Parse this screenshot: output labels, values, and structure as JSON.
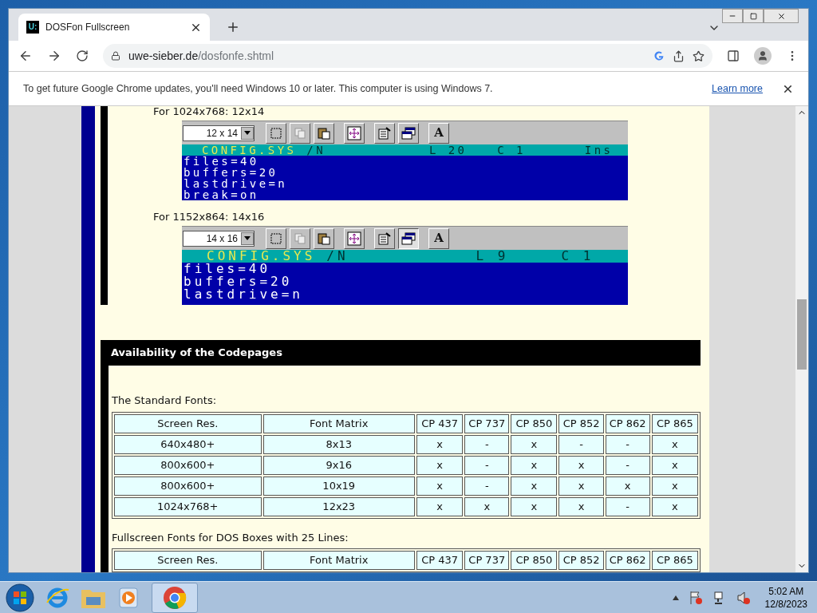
{
  "browser": {
    "tab_title": "DOSFon Fullscreen",
    "favicon_text": "U:",
    "url_host": "uwe-sieber.de",
    "url_path": "/dosfonfe.shtml",
    "infobar": {
      "message": "To get future Google Chrome updates, you'll need Windows 10 or later. This computer is using Windows 7.",
      "link": "Learn more"
    }
  },
  "page": {
    "screenshots": [
      {
        "caption": "For 1024x768: 12x14",
        "font_size": "12 x 14",
        "font_button": "A",
        "file": "CONFIG.SYS",
        "switch": "/N",
        "line": "L 20",
        "col": "C 1",
        "mode": "Ins",
        "lines": [
          "files=40",
          "buffers=20",
          "lastdrive=n",
          "break=on"
        ]
      },
      {
        "caption": "For 1152x864: 14x16",
        "font_size": "14 x 16",
        "font_button": "A",
        "file": "CONFIG.SYS",
        "switch": "/N",
        "line": "L 9",
        "col": "C 1",
        "lines": [
          "files=40",
          "buffers=20",
          "lastdrive=n"
        ]
      }
    ],
    "section_title": "Availability of the Codepages",
    "tables": [
      {
        "caption": "The Standard Fonts:",
        "columns": [
          "Screen Res.",
          "Font Matrix",
          "CP 437",
          "CP 737",
          "CP 850",
          "CP 852",
          "CP 862",
          "CP 865"
        ],
        "rows": [
          [
            "640x480+",
            "8x13",
            "x",
            "-",
            "x",
            "-",
            "-",
            "x"
          ],
          [
            "800x600+",
            "9x16",
            "x",
            "-",
            "x",
            "x",
            "-",
            "x"
          ],
          [
            "800x600+",
            "10x19",
            "x",
            "-",
            "x",
            "x",
            "x",
            "x"
          ],
          [
            "1024x768+",
            "12x23",
            "x",
            "x",
            "x",
            "x",
            "-",
            "x"
          ]
        ]
      },
      {
        "caption": "Fullscreen Fonts for DOS Boxes with 25 Lines:",
        "columns": [
          "Screen Res.",
          "Font Matrix",
          "CP 437",
          "CP 737",
          "CP 850",
          "CP 852",
          "CP 862",
          "CP 865"
        ]
      }
    ]
  },
  "taskbar": {
    "time": "5:02 AM",
    "date": "12/8/2023"
  }
}
